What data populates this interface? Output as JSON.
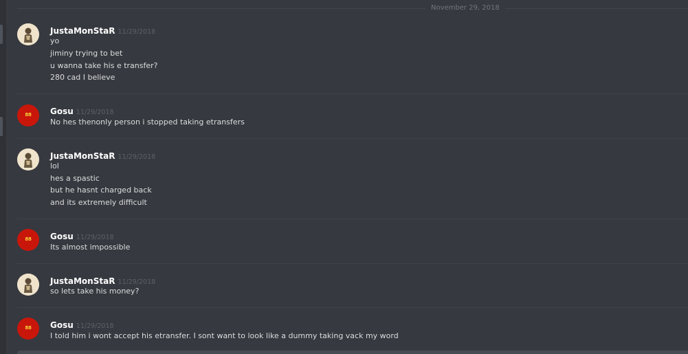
{
  "day_divider": "November 29, 2018",
  "messages": [
    {
      "author": "JustaMonStaR",
      "time": "11/29/2018",
      "lines": [
        "yo",
        "jiminy trying to bet",
        "u wanna take his e transfer?",
        "280 cad I believe"
      ]
    },
    {
      "author": "Gosu",
      "time": "11/29/2018",
      "lines": [
        "No hes thenonly person i stopped taking etransfers"
      ]
    },
    {
      "author": "JustaMonStaR",
      "time": "11/29/2018",
      "lines": [
        "lol",
        "hes a spastic",
        "but he hasnt charged back",
        "and its extremely difficult"
      ]
    },
    {
      "author": "Gosu",
      "time": "11/29/2018",
      "lines": [
        "Its almost impossible"
      ]
    },
    {
      "author": "JustaMonStaR",
      "time": "11/29/2018",
      "lines": [
        "so lets take his money?"
      ]
    },
    {
      "author": "Gosu",
      "time": "11/29/2018",
      "lines": [
        "I told him i wont accept his etransfer. I sont want to look like a dummy taking vack my word"
      ]
    }
  ],
  "avatars": {
    "gosu_text": "88"
  },
  "colors": {
    "background": "#36393f",
    "username": "#ffffff",
    "message_text": "#dcddde",
    "timestamp": "#5d6168",
    "gosu_avatar": "#c9160b"
  }
}
